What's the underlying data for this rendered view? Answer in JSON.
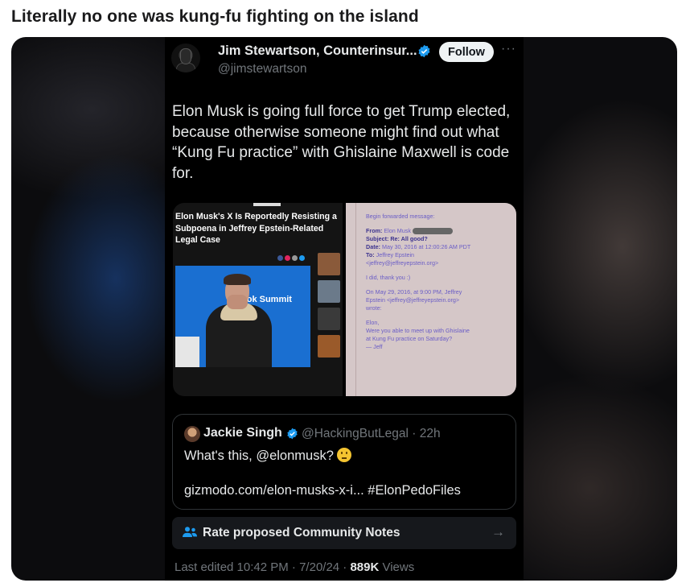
{
  "post": {
    "title": "Literally no one was kung-fu fighting on the island"
  },
  "tweet": {
    "author_name": "Jim Stewartson, Counterinsur...",
    "handle": "@jimstewartson",
    "follow_label": "Follow",
    "more_label": "···",
    "text": "Elon Musk is going full force to get Trump elected, because otherwise someone might find out what “Kung Fu practice” with Ghislaine Maxwell is code for.",
    "image_left": {
      "headline": "Elon Musk's X Is Reportedly Resisting a Subpoena in Jeffrey Epstein-Related Legal Case",
      "banner_text": "ook Summit"
    },
    "image_right": {
      "line1": "Begin forwarded message:",
      "from_label": "From:",
      "from_value": "Elon Musk",
      "subject_label": "Subject:",
      "subject_value": "Re: All good?",
      "date_label": "Date:",
      "date_value": "May 30, 2016 at 12:00:26 AM PDT",
      "to_label": "To:",
      "to_value": "Jeffrey Epstein",
      "to_email": "<jeffrey@jeffreyepstein.org>",
      "reply": "I did, thank you :)",
      "quoted1": "On May 29, 2016, at 9:00 PM, Jeffrey",
      "quoted2": "Epstein <jeffrey@jeffreyepstein.org>",
      "quoted3": "wrote:",
      "quoted4": "Elon,",
      "quoted5": "Were you able to meet up with Ghislaine",
      "quoted6": "at Kung Fu practice on Saturday?",
      "quoted7": "— Jeff"
    },
    "quote": {
      "name": "Jackie Singh",
      "handle_time": "@HackingButLegal · 22h",
      "text": "What's this, @elonmusk?",
      "link": "gizmodo.com/elon-musks-x-i... #ElonPedoFiles"
    },
    "community_notes_label": "Rate proposed Community Notes",
    "meta_prefix": "Last edited 10:42 PM · 7/20/24 · ",
    "views_count": "889K",
    "views_label": " Views"
  },
  "colors": {
    "verified": "#1d9bf0",
    "background": "#000000",
    "text_primary": "#e7e9ea",
    "text_secondary": "#71767b"
  }
}
